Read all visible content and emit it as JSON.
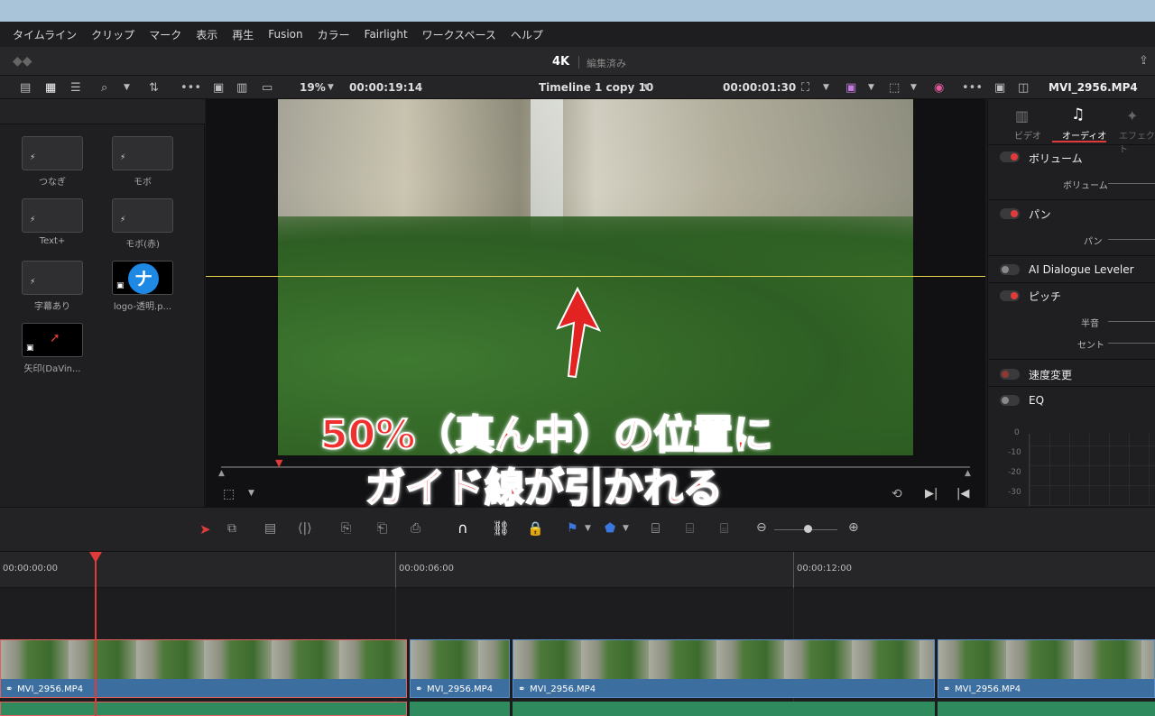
{
  "menu": [
    "タイムライン",
    "クリップ",
    "マーク",
    "表示",
    "再生",
    "Fusion",
    "カラー",
    "Fairlight",
    "ワークスペース",
    "ヘルプ"
  ],
  "project": {
    "name": "4K",
    "status": "編集済み"
  },
  "viewer": {
    "zoom": "19%",
    "source_timecode": "00:00:19:14",
    "timeline_name": "Timeline 1 copy 10",
    "timeline_timecode": "00:00:01:30"
  },
  "inspector": {
    "clip_name": "MVI_2956.MP4",
    "tabs": [
      "ビデオ",
      "オーディオ",
      "エフェクト"
    ],
    "active_tab": "オーディオ"
  },
  "media_pool": {
    "items": [
      {
        "label": "つなぎ"
      },
      {
        "label": "モボ"
      },
      {
        "label": "Text+"
      },
      {
        "label": "モボ(赤)"
      },
      {
        "label": "字幕あり"
      },
      {
        "label": "logo-透明.p..."
      },
      {
        "label": "矢印(DaVin..."
      }
    ]
  },
  "audio_params": {
    "volume": {
      "label": "ボリューム",
      "param": "ボリューム"
    },
    "pan": {
      "label": "パン",
      "param": "パン"
    },
    "dialogue": {
      "label": "AI Dialogue Leveler"
    },
    "pitch": {
      "label": "ピッチ",
      "param1": "半音",
      "param2": "セント"
    },
    "speed": {
      "label": "速度変更"
    },
    "eq": {
      "label": "EQ",
      "scale": [
        "0",
        "-10",
        "-20",
        "-30"
      ]
    }
  },
  "timeline": {
    "ruler": [
      "00:00:00:00",
      "00:00:06:00",
      "00:00:12:00"
    ],
    "clips": [
      "MVI_2956.MP4",
      "MVI_2956.MP4",
      "MVI_2956.MP4",
      "MVI_2956.MP4"
    ]
  },
  "annotation": {
    "line1": "50%（真ん中）の位置に",
    "line2": "ガイド線が引かれる"
  },
  "colors": {
    "guide": "#e8d64a",
    "playhead": "#e03b3b",
    "accent": "#e03b3b"
  }
}
